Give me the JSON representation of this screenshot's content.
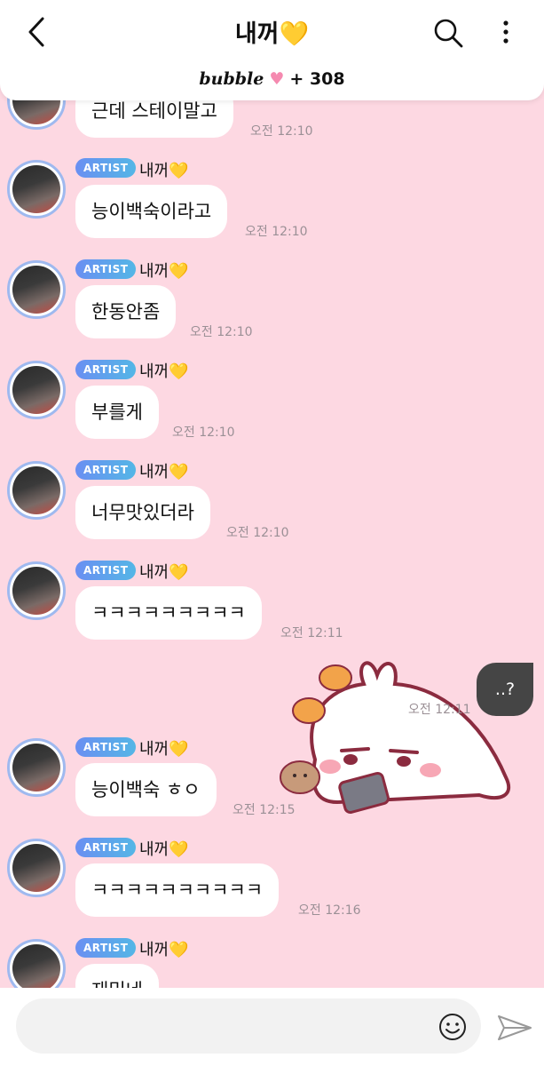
{
  "header": {
    "title": "내꺼💛",
    "brand": "bubble",
    "count": "+ 308",
    "icons": [
      "back-icon",
      "search-icon",
      "more-icon"
    ]
  },
  "messages": [
    {
      "name": "",
      "text": "근데 스테이말고",
      "time": "오전 12:10"
    },
    {
      "badge": "ARTIST",
      "name": "내꺼💛",
      "text": "능이백숙이라고",
      "time": "오전 12:10"
    },
    {
      "badge": "ARTIST",
      "name": "내꺼💛",
      "text": "한동안좀",
      "time": "오전 12:10"
    },
    {
      "badge": "ARTIST",
      "name": "내꺼💛",
      "text": "부를게",
      "time": "오전 12:10"
    },
    {
      "badge": "ARTIST",
      "name": "내꺼💛",
      "text": "너무맛있더라",
      "time": "오전 12:10"
    },
    {
      "badge": "ARTIST",
      "name": "내꺼💛",
      "text": "ㅋㅋㅋㅋㅋㅋㅋㅋㅋ",
      "time": "오전 12:11"
    },
    {
      "badge": "ARTIST",
      "name": "내꺼💛",
      "text": "능이백숙 ㅎㅇ",
      "time": "오전 12:15"
    },
    {
      "badge": "ARTIST",
      "name": "내꺼💛",
      "text": "ㅋㅋㅋㅋㅋㅋㅋㅋㅋㅋ",
      "time": "오전 12:16"
    },
    {
      "badge": "ARTIST",
      "name": "내꺼💛",
      "text": "재밌네",
      "time": ""
    }
  ],
  "my_message": {
    "text": "..?",
    "time": "오전 12:11"
  },
  "input": {
    "placeholder": ""
  },
  "colors": {
    "background": "#fdd8e2",
    "badge": "#6a8ff2",
    "my_bubble": "#454545"
  }
}
